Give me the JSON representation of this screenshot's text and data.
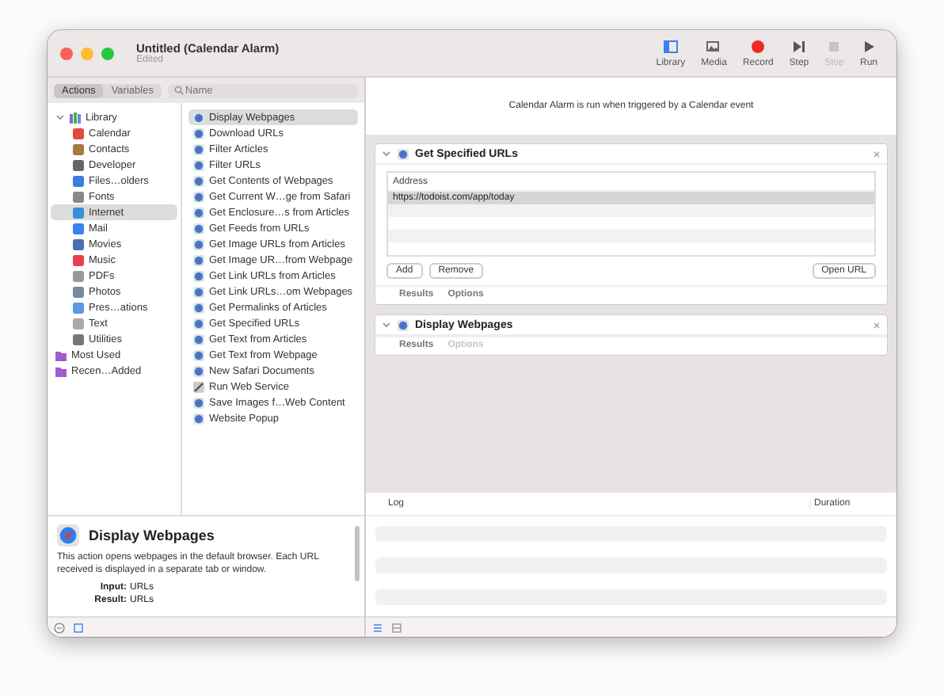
{
  "window": {
    "title": "Untitled (Calendar Alarm)",
    "subtitle": "Edited"
  },
  "toolbar": [
    {
      "label": "Library",
      "kind": "library",
      "disabled": false
    },
    {
      "label": "Media",
      "kind": "media",
      "disabled": false
    },
    {
      "label": "Record",
      "kind": "record",
      "disabled": false
    },
    {
      "label": "Step",
      "kind": "step",
      "disabled": false
    },
    {
      "label": "Stop",
      "kind": "stop",
      "disabled": true
    },
    {
      "label": "Run",
      "kind": "run",
      "disabled": false
    }
  ],
  "library_tabs": [
    {
      "label": "Actions",
      "selected": true
    },
    {
      "label": "Variables",
      "selected": false
    }
  ],
  "search": {
    "placeholder": "Name"
  },
  "library": [
    {
      "label": "Library",
      "kind": "library",
      "expanded": true,
      "selected": false,
      "children": [
        {
          "label": "Calendar",
          "kind": "category",
          "selected": false
        },
        {
          "label": "Contacts",
          "kind": "category",
          "selected": false
        },
        {
          "label": "Developer",
          "kind": "category",
          "selected": false
        },
        {
          "label": "Files…olders",
          "kind": "category",
          "selected": false
        },
        {
          "label": "Fonts",
          "kind": "category",
          "selected": false
        },
        {
          "label": "Internet",
          "kind": "category",
          "selected": true
        },
        {
          "label": "Mail",
          "kind": "category",
          "selected": false
        },
        {
          "label": "Movies",
          "kind": "category",
          "selected": false
        },
        {
          "label": "Music",
          "kind": "category",
          "selected": false
        },
        {
          "label": "PDFs",
          "kind": "category",
          "selected": false
        },
        {
          "label": "Photos",
          "kind": "category",
          "selected": false
        },
        {
          "label": "Pres…ations",
          "kind": "category",
          "selected": false
        },
        {
          "label": "Text",
          "kind": "category",
          "selected": false
        },
        {
          "label": "Utilities",
          "kind": "category",
          "selected": false
        }
      ]
    },
    {
      "label": "Most Used",
      "kind": "folder",
      "selected": false
    },
    {
      "label": "Recen…Added",
      "kind": "folder",
      "selected": false
    }
  ],
  "actions": [
    {
      "label": "Display Webpages",
      "kind": "safari",
      "selected": true
    },
    {
      "label": "Download URLs",
      "kind": "safari",
      "selected": false
    },
    {
      "label": "Filter Articles",
      "kind": "safari",
      "selected": false
    },
    {
      "label": "Filter URLs",
      "kind": "safari",
      "selected": false
    },
    {
      "label": "Get Contents of Webpages",
      "kind": "safari",
      "selected": false
    },
    {
      "label": "Get Current W…ge from Safari",
      "kind": "safari",
      "selected": false
    },
    {
      "label": "Get Enclosure…s from Articles",
      "kind": "safari",
      "selected": false
    },
    {
      "label": "Get Feeds from URLs",
      "kind": "safari",
      "selected": false
    },
    {
      "label": "Get Image URLs from Articles",
      "kind": "safari",
      "selected": false
    },
    {
      "label": "Get Image UR…from Webpage",
      "kind": "safari",
      "selected": false
    },
    {
      "label": "Get Link URLs from Articles",
      "kind": "safari",
      "selected": false
    },
    {
      "label": "Get Link URLs…om Webpages",
      "kind": "safari",
      "selected": false
    },
    {
      "label": "Get Permalinks of Articles",
      "kind": "safari",
      "selected": false
    },
    {
      "label": "Get Specified URLs",
      "kind": "safari",
      "selected": false
    },
    {
      "label": "Get Text from Articles",
      "kind": "safari",
      "selected": false
    },
    {
      "label": "Get Text from Webpage",
      "kind": "safari",
      "selected": false
    },
    {
      "label": "New Safari Documents",
      "kind": "safari",
      "selected": false
    },
    {
      "label": "Run Web Service",
      "kind": "service",
      "selected": false
    },
    {
      "label": "Save Images f…Web Content",
      "kind": "safari",
      "selected": false
    },
    {
      "label": "Website Popup",
      "kind": "safari",
      "selected": false
    }
  ],
  "description": {
    "title": "Display Webpages",
    "text": "This action opens webpages in the default browser. Each URL received is displayed in a separate tab or window.",
    "fields": [
      {
        "label": "Input:",
        "value": "URLs"
      },
      {
        "label": "Result:",
        "value": "URLs"
      }
    ]
  },
  "trigger_banner": "Calendar Alarm is run when triggered by a Calendar event",
  "workflow": [
    {
      "title": "Get Specified URLs",
      "expanded": true,
      "table": {
        "column": "Address",
        "rows": [
          {
            "address": "https://todoist.com/app/today",
            "selected": true
          }
        ]
      },
      "buttons": [
        "Add",
        "Remove"
      ],
      "side_button": "Open URL",
      "tabs": [
        {
          "label": "Results",
          "disabled": false
        },
        {
          "label": "Options",
          "disabled": false
        }
      ]
    },
    {
      "title": "Display Webpages",
      "expanded": true,
      "tabs": [
        {
          "label": "Results",
          "disabled": false
        },
        {
          "label": "Options",
          "disabled": true
        }
      ]
    }
  ],
  "log": {
    "columns": [
      "Log",
      "Duration"
    ]
  }
}
